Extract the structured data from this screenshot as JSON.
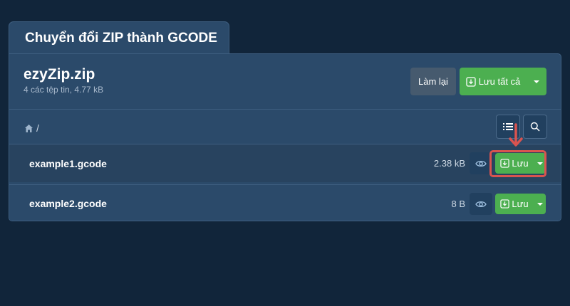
{
  "tab": {
    "title": "Chuyển đổi ZIP thành GCODE"
  },
  "archive": {
    "name": "ezyZip.zip",
    "meta": "4 các tệp tin, 4.77 kB"
  },
  "actions": {
    "reset_label": "Làm lại",
    "save_all_label": "Lưu tất cả"
  },
  "breadcrumb": {
    "separator": "/"
  },
  "files": [
    {
      "name": "example1.gcode",
      "size": "2.38 kB",
      "save_label": "Lưu"
    },
    {
      "name": "example2.gcode",
      "size": "8 B",
      "save_label": "Lưu"
    }
  ],
  "colors": {
    "background": "#11253a",
    "panel": "#2b4a6a",
    "accent_green": "#4caf50",
    "highlight_red": "#d9534f"
  },
  "icons": [
    "home-icon",
    "list-icon",
    "search-icon",
    "eye-icon",
    "download-icon",
    "chevron-down-icon",
    "arrow-down-icon"
  ]
}
